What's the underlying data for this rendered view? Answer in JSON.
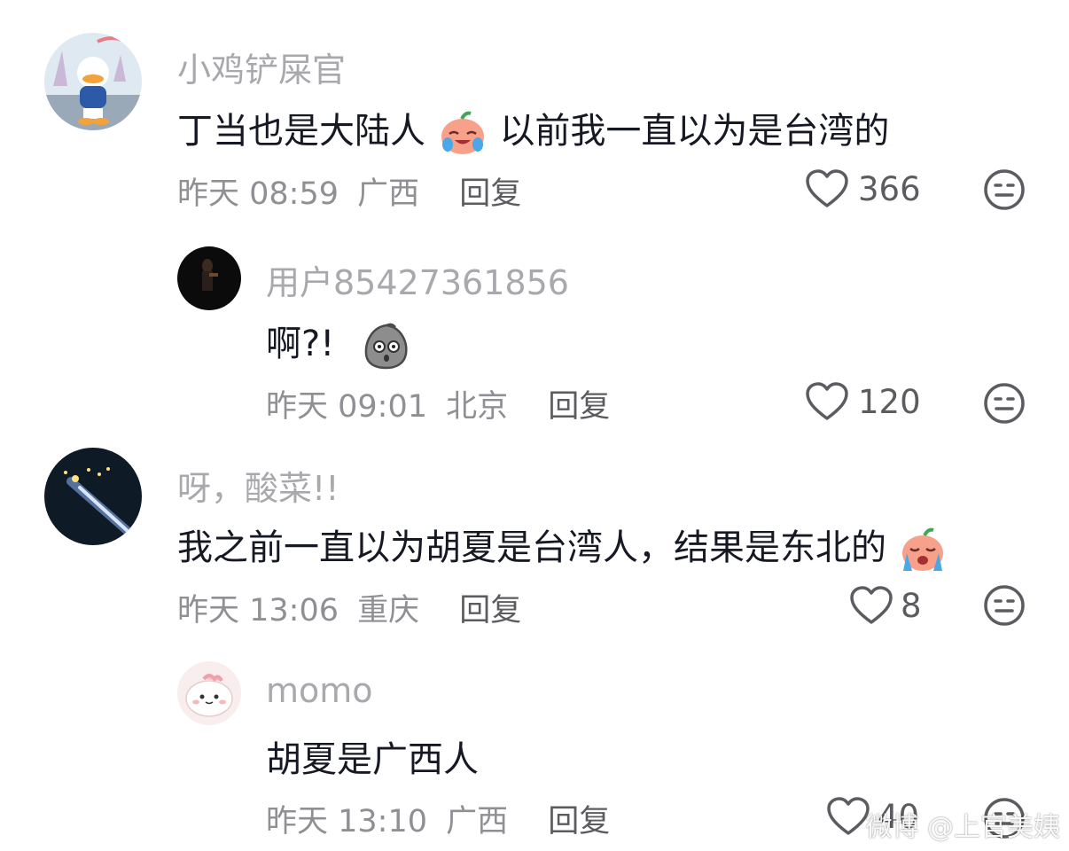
{
  "comments": [
    {
      "username": "小鸡铲屎官",
      "text_before": "丁当也是大陆人",
      "text_after": "以前我一直以为是台湾的",
      "emoji": "crying-laughing-peach-emoji",
      "time": "昨天 08:59",
      "location": "广西",
      "reply_label": "回复",
      "likes": "366"
    },
    {
      "username": "用户85427361856",
      "text_before": "啊?!",
      "text_after": "",
      "emoji": "shocked-gray-blob-emoji",
      "time": "昨天 09:01",
      "location": "北京",
      "reply_label": "回复",
      "likes": "120"
    },
    {
      "username": "呀，酸菜!!",
      "text_before": "我之前一直以为胡夏是台湾人，结果是东北的",
      "text_after": "",
      "emoji": "sobbing-peach-emoji",
      "time": "昨天 13:06",
      "location": "重庆",
      "reply_label": "回复",
      "likes": "8"
    },
    {
      "username": "momo",
      "text_before": "胡夏是广西人",
      "text_after": "",
      "emoji": "",
      "time": "昨天 13:10",
      "location": "广西",
      "reply_label": "回复",
      "likes": "40"
    }
  ],
  "icons": {
    "like": "heart-outline-icon",
    "dislike": "meh-face-icon"
  },
  "watermark": "微博 @上官美姨",
  "colors": {
    "username": "#a8a8ad",
    "meta": "#8f8f94",
    "text": "#161823",
    "icon": "#5c5c60"
  }
}
